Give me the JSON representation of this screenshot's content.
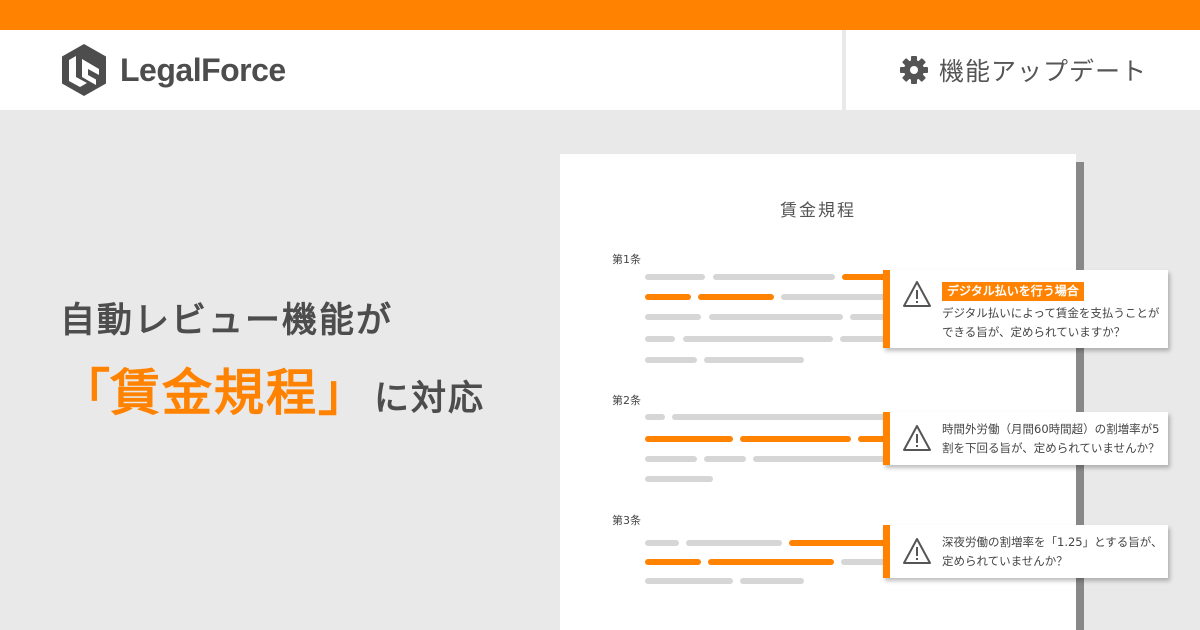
{
  "brand": {
    "name": "LegalForce",
    "accent_color": "#ff8200",
    "text_color": "#4d4d4d",
    "logo_icon": "legalforce-logo-icon"
  },
  "badge": {
    "icon": "gear-icon",
    "label": "機能アップデート"
  },
  "headline": {
    "line1": "自動レビュー機能が",
    "open_bracket": "「",
    "emphasis": "賃金規程",
    "close_bracket": "」",
    "suffix": "に対応"
  },
  "document": {
    "title": "賃金規程",
    "articles": [
      {
        "label": "第1条",
        "callout_tag": "デジタル払いを行う場合",
        "callout_text": "デジタル払いによって賃金を支払うことができる旨が、定められていますか？"
      },
      {
        "label": "第2条",
        "callout_text": "時間外労働（月間60時間超）の割増率が5割を下回る旨が、定められていませんか？"
      },
      {
        "label": "第3条",
        "callout_text": "深夜労働の割増率を「1.25」とする旨が、定められていませんか？"
      }
    ],
    "warning_icon": "warning-icon"
  }
}
